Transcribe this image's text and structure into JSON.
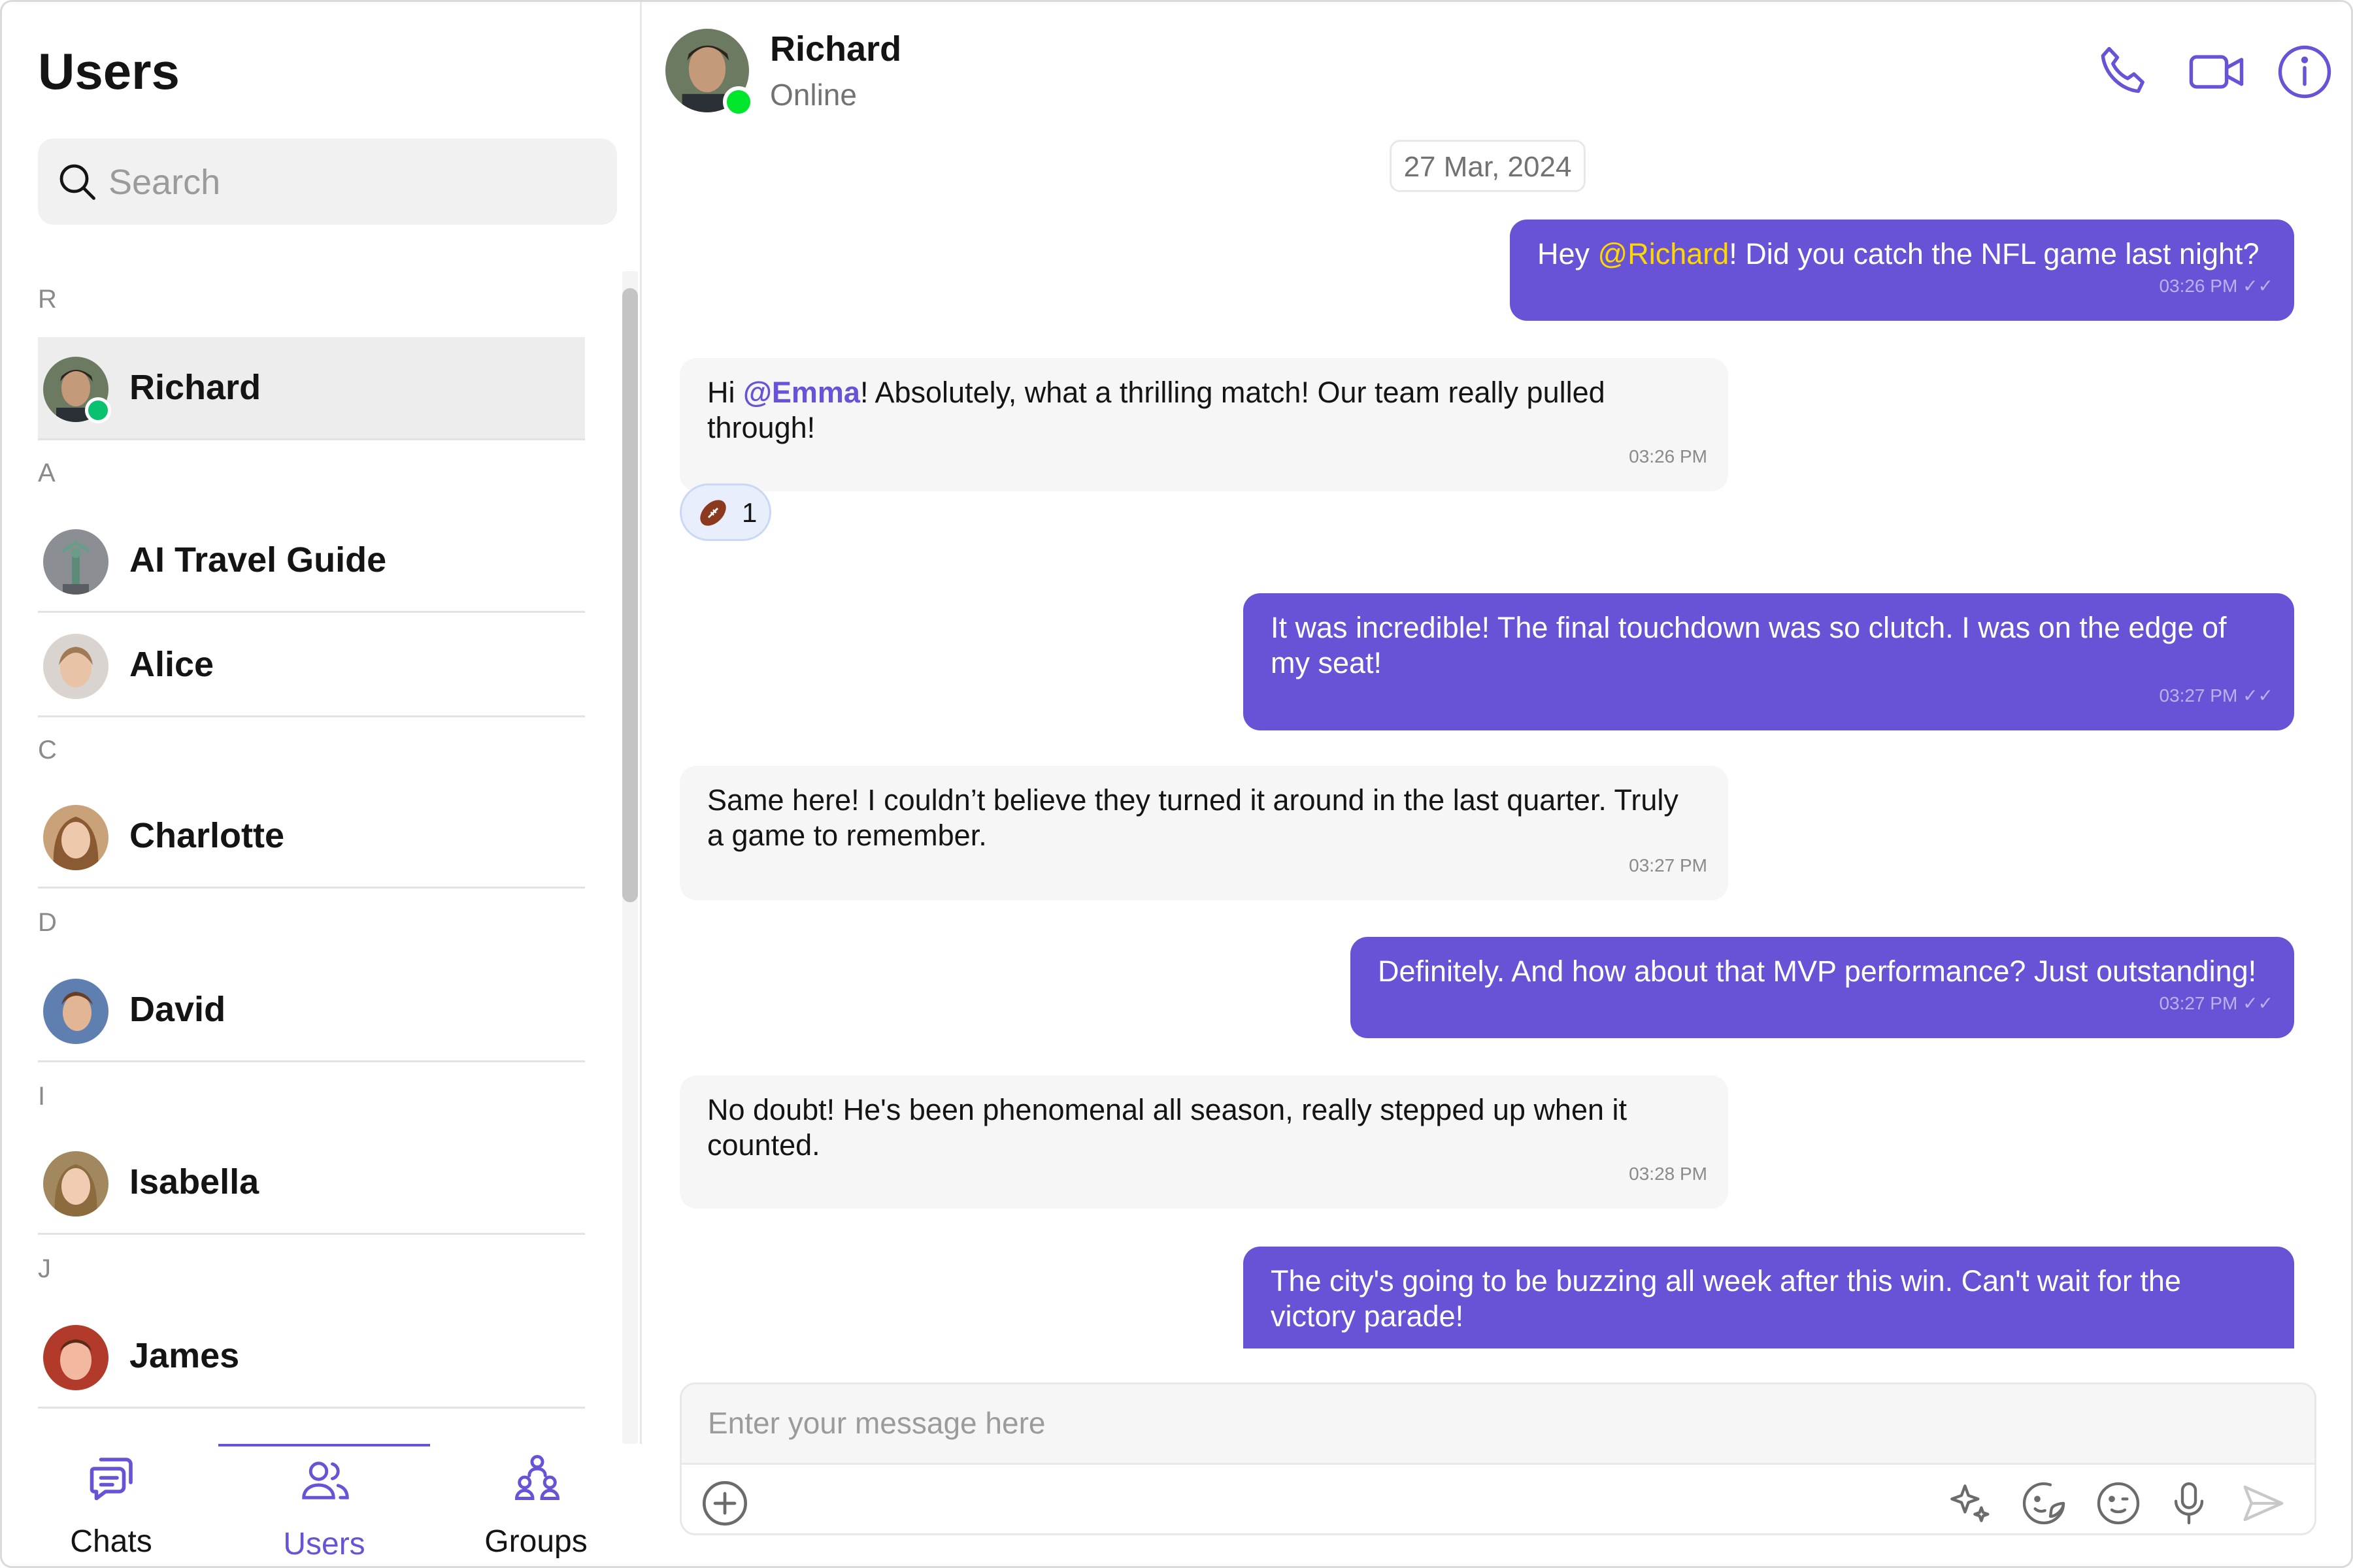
{
  "sidebar": {
    "title": "Users",
    "search_placeholder": "Search",
    "sections": [
      {
        "letter": "R"
      },
      {
        "letter": "A"
      },
      {
        "letter": "C"
      },
      {
        "letter": "D"
      },
      {
        "letter": "I"
      },
      {
        "letter": "J"
      }
    ],
    "users": [
      {
        "name": "Richard",
        "online": true,
        "selected": true
      },
      {
        "name": "AI Travel Guide"
      },
      {
        "name": "Alice"
      },
      {
        "name": "Charlotte"
      },
      {
        "name": "David"
      },
      {
        "name": "Isabella"
      },
      {
        "name": "James"
      }
    ],
    "nav": [
      {
        "label": "Chats",
        "icon": "chats-icon"
      },
      {
        "label": "Users",
        "icon": "users-icon",
        "active": true
      },
      {
        "label": "Groups",
        "icon": "groups-icon"
      }
    ]
  },
  "chat": {
    "header": {
      "name": "Richard",
      "status": "Online",
      "icons": [
        "phone-icon",
        "video-icon",
        "info-icon"
      ]
    },
    "date_separator": "27 Mar, 2024",
    "messages": [
      {
        "direction": "outgoing",
        "pre": "Hey ",
        "mention": "@Richard",
        "post": "! Did you catch the NFL game last night?",
        "time": "03:26 PM",
        "read": true
      },
      {
        "direction": "incoming",
        "pre": "Hi ",
        "mention": "@Emma",
        "post": "! Absolutely, what a thrilling match! Our team really pulled through!",
        "time": "03:26 PM"
      },
      {
        "direction": "outgoing",
        "text": "It was incredible! The final touchdown was so clutch. I was on the edge of my seat!",
        "time": "03:27 PM",
        "read": true
      },
      {
        "direction": "incoming",
        "text": "Same here! I couldn’t believe they turned it around in the last quarter. Truly a game to remember.",
        "time": "03:27 PM"
      },
      {
        "direction": "outgoing",
        "text": "Definitely. And how about that MVP performance? Just outstanding!",
        "time": "03:27 PM",
        "read": true
      },
      {
        "direction": "incoming",
        "text": "No doubt! He's been phenomenal all season, really stepped up when it counted.",
        "time": "03:28 PM"
      },
      {
        "direction": "outgoing",
        "text": "The city's going to be buzzing all week after this win. Can't wait for the victory parade!"
      }
    ],
    "reaction": {
      "emoji": "american-football",
      "count": "1"
    },
    "composer": {
      "placeholder": "Enter your message here",
      "icons": [
        "add-icon",
        "ai-sparkle-icon",
        "sticker-icon",
        "emoji-icon",
        "microphone-icon",
        "send-icon"
      ]
    }
  },
  "colors": {
    "accent": "#6852d6",
    "online": "#09c26f",
    "mention_outgoing": "#ffd700",
    "incoming_bubble": "#f6f6f6"
  }
}
